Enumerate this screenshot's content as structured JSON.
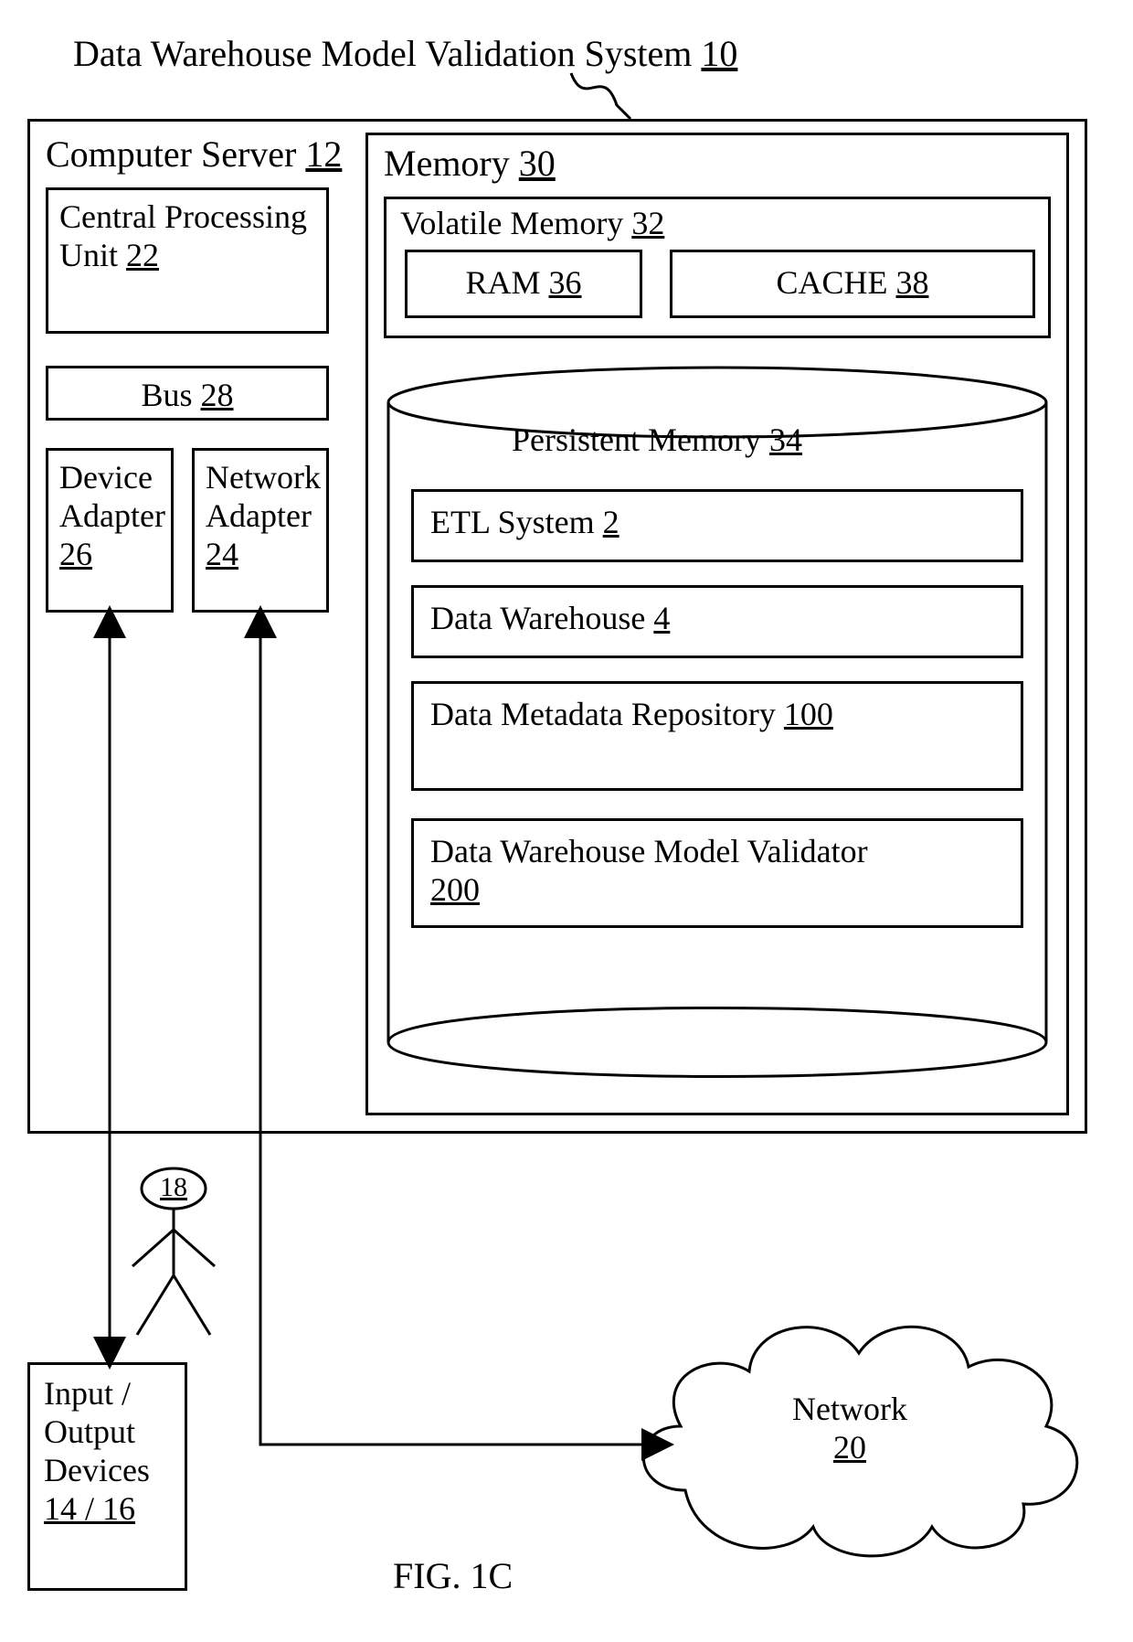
{
  "title": {
    "text": "Data Warehouse Model Validation System",
    "ref": "10"
  },
  "server": {
    "label": "Computer Server",
    "ref": "12"
  },
  "cpu": {
    "label": "Central Processing Unit",
    "ref": "22"
  },
  "bus": {
    "label": "Bus",
    "ref": "28"
  },
  "devadapter": {
    "label": "Device Adapter",
    "ref": "26"
  },
  "netadapter": {
    "label": "Network Adapter",
    "ref": "24"
  },
  "memory": {
    "label": "Memory",
    "ref": "30"
  },
  "volatile": {
    "label": "Volatile Memory",
    "ref": "32"
  },
  "ram": {
    "label": "RAM",
    "ref": "36"
  },
  "cache": {
    "label": "CACHE",
    "ref": "38"
  },
  "persistent": {
    "label": "Persistent Memory",
    "ref": "34"
  },
  "etl": {
    "label": "ETL System",
    "ref": "2"
  },
  "dw": {
    "label": "Data Warehouse",
    "ref": "4"
  },
  "meta": {
    "label": "Data Metadata Repository",
    "ref": "100"
  },
  "dwmv": {
    "label": "Data Warehouse Model Validator",
    "ref": "200"
  },
  "user": {
    "ref": "18"
  },
  "io": {
    "label": "Input / Output Devices",
    "ref": "14 / 16"
  },
  "network": {
    "label": "Network",
    "ref": "20"
  },
  "figure": {
    "label": "FIG. 1C"
  }
}
